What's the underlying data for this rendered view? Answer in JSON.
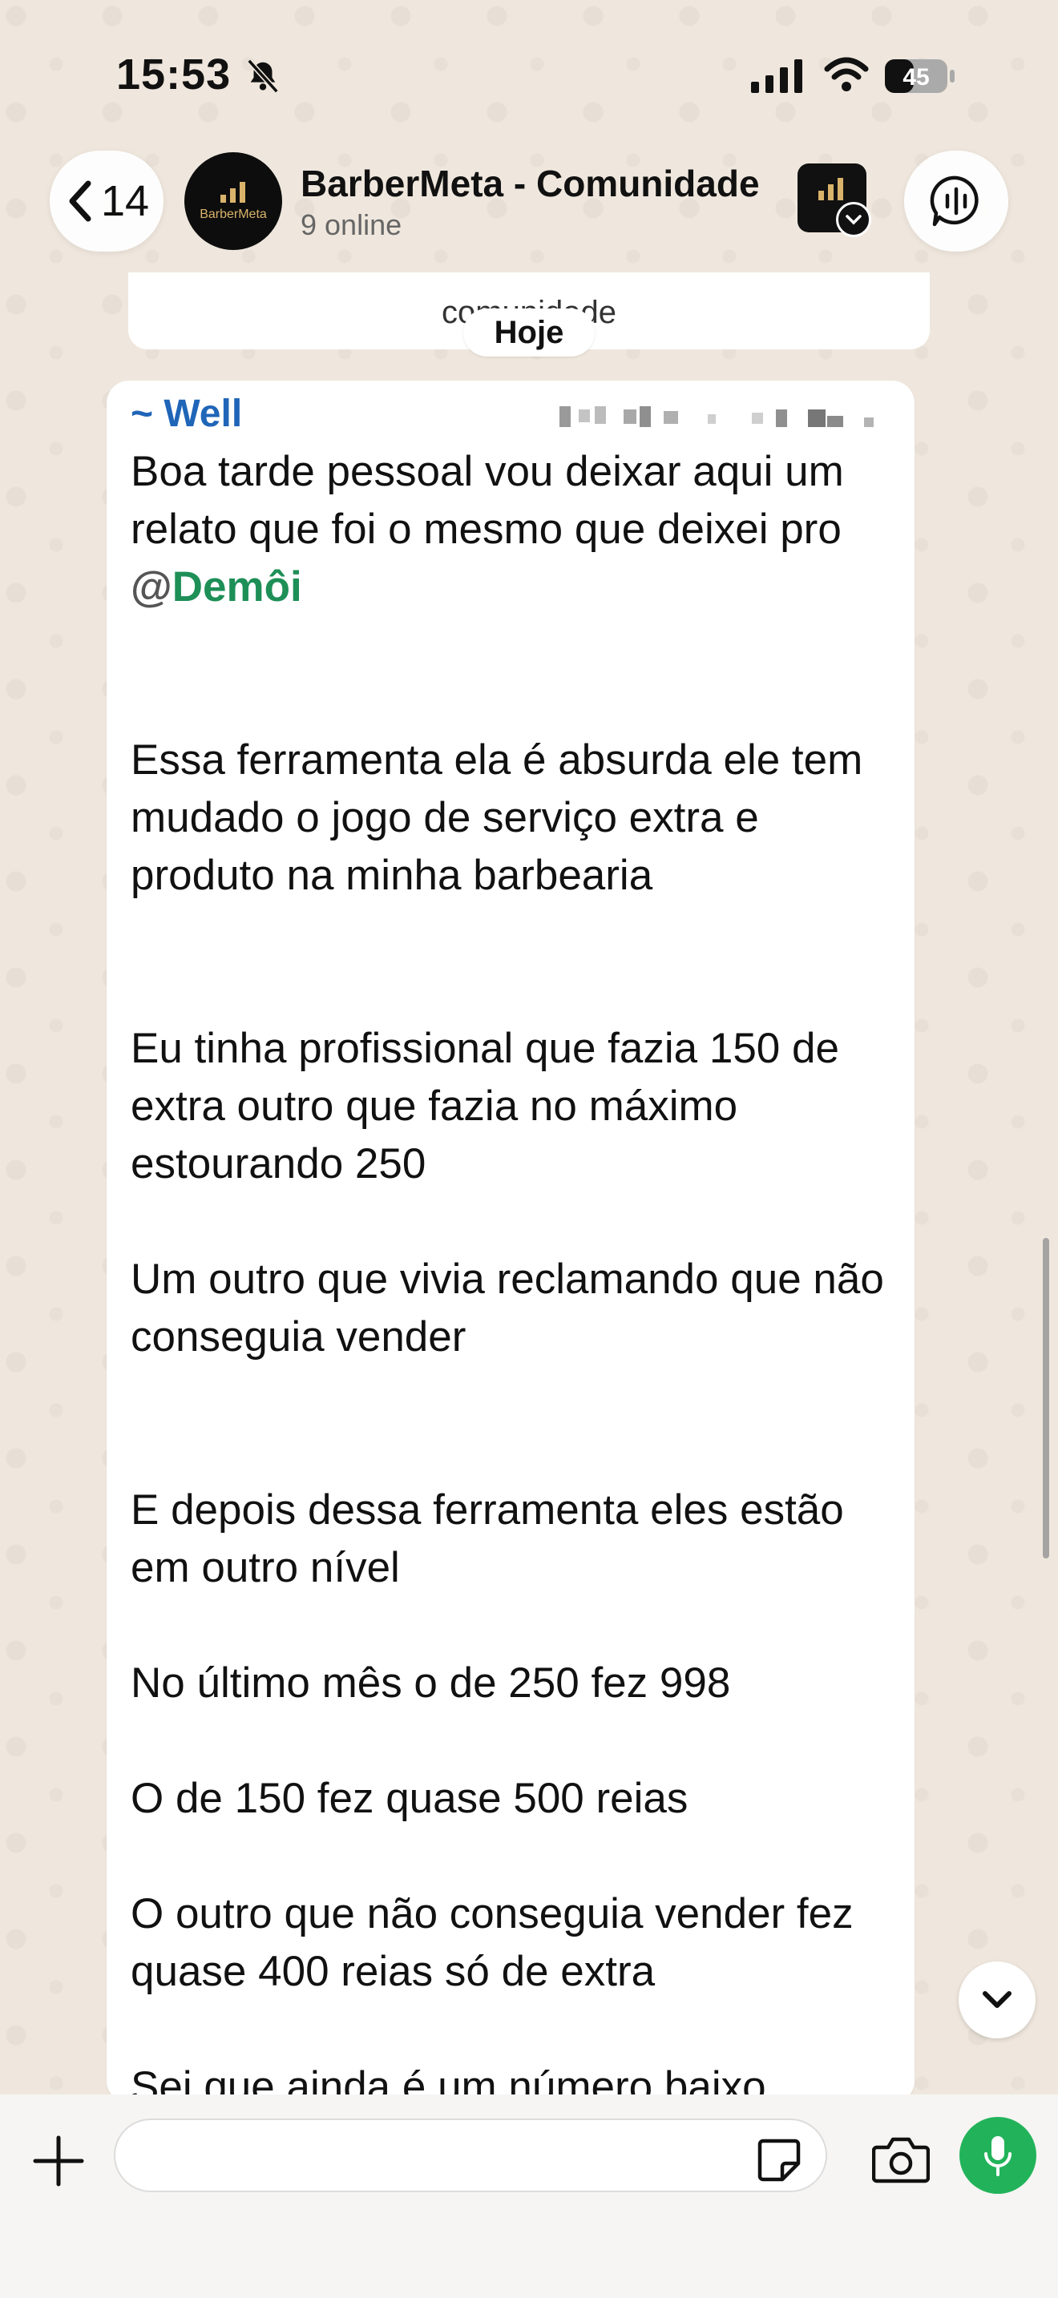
{
  "status_bar": {
    "time": "15:53",
    "battery": "45",
    "icons": [
      "bell-slash-icon",
      "signal-icon",
      "wifi-icon",
      "battery-icon"
    ]
  },
  "header": {
    "back_count": "14",
    "title": "BarberMeta - Comunidade",
    "subtitle": "9 online",
    "avatar_brand": "BarberMeta",
    "icons": [
      "chevron-left-icon",
      "group-avatar",
      "community-icon",
      "voice-chat-icon"
    ]
  },
  "previous_message": {
    "tail_text": "comunidade"
  },
  "date_chip": "Hoje",
  "message": {
    "sender": "~ Well",
    "paragraphs": [
      {
        "before": "Boa tarde pessoal vou deixar aqui um relato que foi o mesmo que deixei pro ",
        "mention_at": "@",
        "mention": "Demôi"
      },
      {
        "text": "Essa ferramenta ela é absurda ele tem mudado o jogo de serviço extra e produto na minha barbearia"
      },
      {
        "text": "Eu tinha profissional que fazia 150 de extra outro que fazia no máximo estourando 250"
      },
      {
        "text": "Um outro  que vivia reclamando que não conseguia vender"
      },
      {
        "text": "E depois dessa ferramenta eles estão em outro nível"
      },
      {
        "text": "No último mês o de 250 fez 998"
      },
      {
        "text": "O de 150 fez quase 500 reias"
      },
      {
        "text": "O outro que não conseguia vender fez quase 400 reias só de extra"
      },
      {
        "text": "Sei que ainda é um número baixo"
      }
    ]
  },
  "colors": {
    "sender": "#1f65b8",
    "mention": "#1d8f57",
    "mic": "#22b35a",
    "wallpaper": "#efe7dd"
  },
  "input": {
    "placeholder": "",
    "icons": [
      "plus-icon",
      "sticker-icon",
      "camera-icon",
      "microphone-icon"
    ]
  }
}
